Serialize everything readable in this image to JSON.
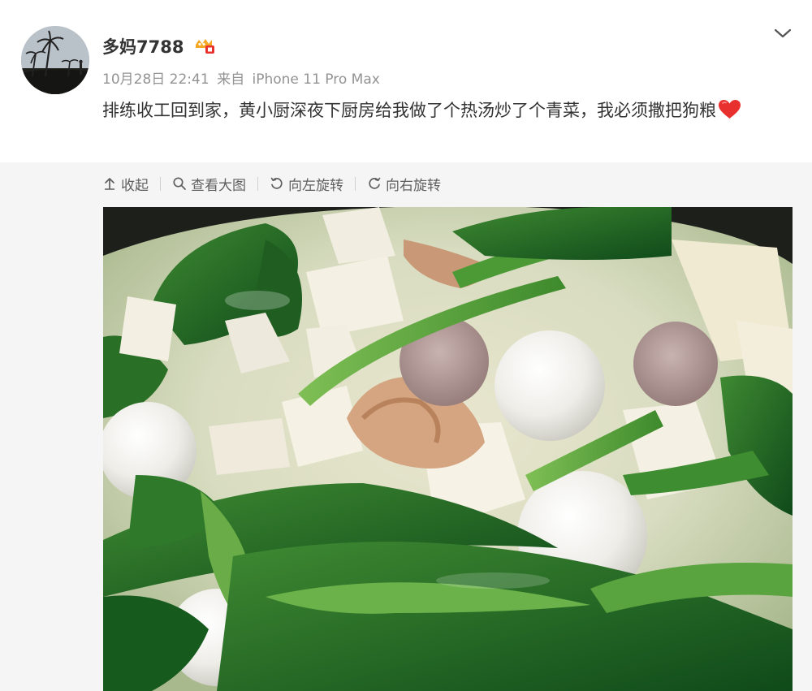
{
  "post": {
    "user_name": "多妈7788",
    "date": "10月28日 22:41",
    "source_prefix": "来自",
    "source_device": "iPhone 11 Pro Max",
    "text": "排练收工回到家，黄小厨深夜下厨房给我做了个热汤炒了个青菜，我必须撒把狗粮"
  },
  "icons": {
    "vip": "vip-badge-icon",
    "more": "chevron-down-icon",
    "emoji": "red-heart-icon",
    "collapse": "collapse-arrow-icon",
    "view_large": "magnifier-icon",
    "rotate_left": "rotate-left-icon",
    "rotate_right": "rotate-right-icon"
  },
  "toolbar": {
    "collapse_label": "收起",
    "view_large_label": "查看大图",
    "rotate_left_label": "向左旋转",
    "rotate_right_label": "向右旋转"
  },
  "colors": {
    "text": "#333333",
    "meta": "#939393",
    "toolbar_text": "#5f5f5f",
    "media_bg": "#f5f5f5",
    "heart": "#e8312f",
    "badge": "#f5a623"
  }
}
